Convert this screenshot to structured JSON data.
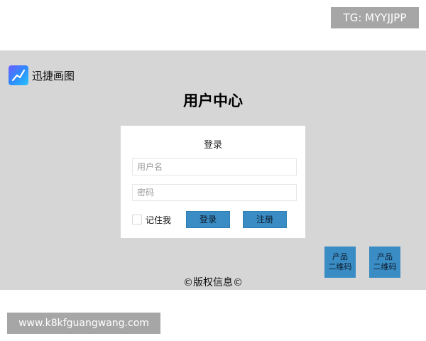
{
  "overlay": {
    "tg_badge": "TG: MYYJJPP",
    "url_badge": "www.k8kfguangwang.com"
  },
  "header": {
    "logo_text": "迅捷画图",
    "logo_icon": "trend-line-icon",
    "page_title": "用户中心"
  },
  "login": {
    "title": "登录",
    "username_placeholder": "用户名",
    "password_placeholder": "密码",
    "remember_label": "记住我",
    "login_label": "登录",
    "register_label": "注册"
  },
  "qr_codes": [
    {
      "line1": "产品",
      "line2": "二维码"
    },
    {
      "line1": "产品",
      "line2": "二维码"
    }
  ],
  "footer": {
    "copyright": "©版权信息©"
  },
  "colors": {
    "frame_bg": "#d6d6d6",
    "button_blue": "#3a8cc4",
    "badge_gray": "#a6a6a6"
  }
}
